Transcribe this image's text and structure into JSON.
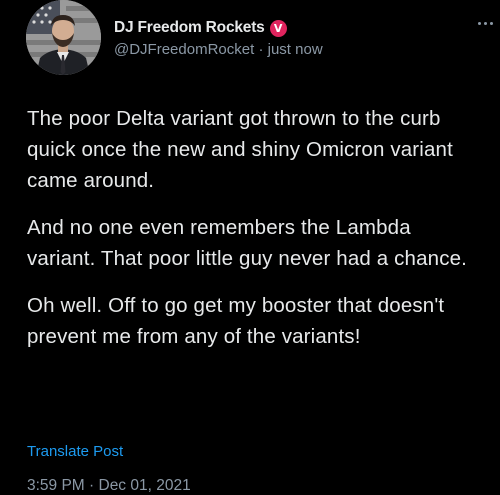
{
  "post": {
    "author": {
      "display_name": "DJ Freedom Rockets",
      "badge": "V",
      "handle": "@DJFreedomRocket",
      "separator": "·",
      "relative_time": "just now"
    },
    "menu_icon": "more-horizontal-icon",
    "paragraphs": [
      "The poor Delta variant got thrown to the curb quick once the new and shiny Omicron variant came around.",
      "And no one even remembers the Lambda variant. That poor little guy never had a chance.",
      "Oh well. Off to go get my booster that doesn't prevent me from any of the variants!"
    ],
    "translate_label": "Translate Post",
    "timestamp": "3:59 PM · Dec 01, 2021"
  },
  "colors": {
    "background": "#000000",
    "text": "#e7e9ea",
    "secondary_text": "#8b98a5",
    "link": "#1d9bf0",
    "badge": "#e0245e"
  }
}
